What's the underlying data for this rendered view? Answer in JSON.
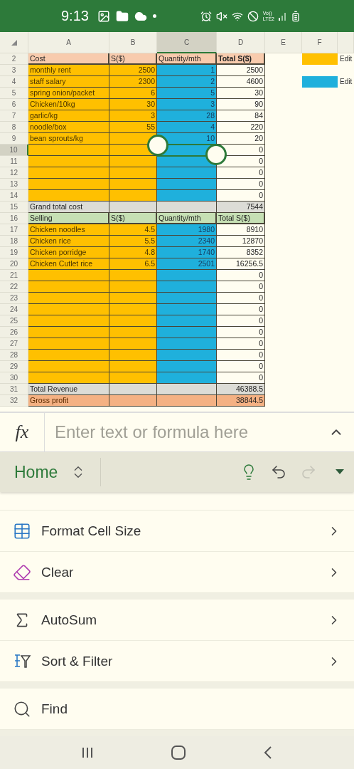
{
  "status_bar": {
    "time": "9:13",
    "network_top": "Vo))",
    "network_bottom": "LTE2"
  },
  "sheet": {
    "columns": [
      {
        "label": "A",
        "selected": false
      },
      {
        "label": "B",
        "selected": false
      },
      {
        "label": "C",
        "selected": true
      },
      {
        "label": "D",
        "selected": false
      },
      {
        "label": "E",
        "selected": false
      },
      {
        "label": "F",
        "selected": false
      }
    ],
    "legend": [
      {
        "color": "#ffc000",
        "label": "Edit"
      },
      {
        "color": "#1fb0dc",
        "label": "Edit"
      }
    ],
    "rows": [
      {
        "num": "2",
        "kind": "cost_header",
        "selected": false,
        "a": "Cost",
        "b": "S($)",
        "c": "Quantity/mth",
        "d": "Total S($)"
      },
      {
        "num": "3",
        "kind": "entry",
        "selected": false,
        "a": "monthly rent",
        "b": "2500",
        "c": "1",
        "d": "2500"
      },
      {
        "num": "4",
        "kind": "entry",
        "selected": false,
        "a": "staff salary",
        "b": "2300",
        "c": "2",
        "d": "4600"
      },
      {
        "num": "5",
        "kind": "entry",
        "selected": false,
        "a": "spring onion/packet",
        "b": "6",
        "c": "5",
        "d": "30"
      },
      {
        "num": "6",
        "kind": "entry",
        "selected": false,
        "a": "Chicken/10kg",
        "b": "30",
        "c": "3",
        "d": "90"
      },
      {
        "num": "7",
        "kind": "entry",
        "selected": false,
        "a": "garlic/kg",
        "b": "3",
        "c": "28",
        "d": "84"
      },
      {
        "num": "8",
        "kind": "entry",
        "selected": false,
        "a": "noodle/box",
        "b": "55",
        "c": "4",
        "d": "220"
      },
      {
        "num": "9",
        "kind": "entry",
        "selected": false,
        "a": "bean sprouts/kg",
        "c": "10",
        "d": "20"
      },
      {
        "num": "10",
        "kind": "entry",
        "selected": true,
        "d": "0"
      },
      {
        "num": "11",
        "kind": "entry",
        "selected": false,
        "d": "0"
      },
      {
        "num": "12",
        "kind": "entry",
        "selected": false,
        "d": "0"
      },
      {
        "num": "13",
        "kind": "entry",
        "selected": false,
        "d": "0"
      },
      {
        "num": "14",
        "kind": "entry",
        "selected": false,
        "d": "0"
      },
      {
        "num": "15",
        "kind": "total",
        "selected": false,
        "a": "Grand total cost",
        "d": "7544"
      },
      {
        "num": "16",
        "kind": "sell_header",
        "selected": false,
        "a": "Selling",
        "b": "S($)",
        "c": "Quantity/mth",
        "d": "Total S($)"
      },
      {
        "num": "17",
        "kind": "entry",
        "selected": false,
        "a": "Chicken noodles",
        "b": "4.5",
        "c": "1980",
        "d": "8910"
      },
      {
        "num": "18",
        "kind": "entry",
        "selected": false,
        "a": "Chicken rice",
        "b": "5.5",
        "c": "2340",
        "d": "12870"
      },
      {
        "num": "19",
        "kind": "entry",
        "selected": false,
        "a": "Chicken porridge",
        "b": "4.8",
        "c": "1740",
        "d": "8352"
      },
      {
        "num": "20",
        "kind": "entry",
        "selected": false,
        "a": "Chicken Cutlet rice",
        "b": "6.5",
        "c": "2501",
        "d": "16256.5"
      },
      {
        "num": "21",
        "kind": "entry",
        "selected": false,
        "d": "0"
      },
      {
        "num": "22",
        "kind": "entry",
        "selected": false,
        "d": "0"
      },
      {
        "num": "23",
        "kind": "entry",
        "selected": false,
        "d": "0"
      },
      {
        "num": "24",
        "kind": "entry",
        "selected": false,
        "d": "0"
      },
      {
        "num": "25",
        "kind": "entry",
        "selected": false,
        "d": "0"
      },
      {
        "num": "26",
        "kind": "entry",
        "selected": false,
        "d": "0"
      },
      {
        "num": "27",
        "kind": "entry",
        "selected": false,
        "d": "0"
      },
      {
        "num": "28",
        "kind": "entry",
        "selected": false,
        "d": "0"
      },
      {
        "num": "29",
        "kind": "entry",
        "selected": false,
        "d": "0"
      },
      {
        "num": "30",
        "kind": "entry",
        "selected": false,
        "d": "0"
      },
      {
        "num": "31",
        "kind": "total",
        "selected": false,
        "a": "Total Revenue",
        "d": "46388.5"
      },
      {
        "num": "32",
        "kind": "profit",
        "selected": false,
        "a": "Gross profit",
        "d": "38844.5"
      }
    ]
  },
  "formula_bar": {
    "label": "fx",
    "placeholder": "Enter text or formula here"
  },
  "ribbon": {
    "tab": "Home",
    "redo_disabled": true
  },
  "menu": [
    [
      {
        "label": "Format Cell Size",
        "submenu": true
      },
      {
        "label": "Clear",
        "submenu": true
      }
    ],
    [
      {
        "label": "AutoSum",
        "submenu": true
      },
      {
        "label": "Sort & Filter",
        "submenu": true
      }
    ],
    [
      {
        "label": "Find",
        "submenu": false
      }
    ]
  ]
}
